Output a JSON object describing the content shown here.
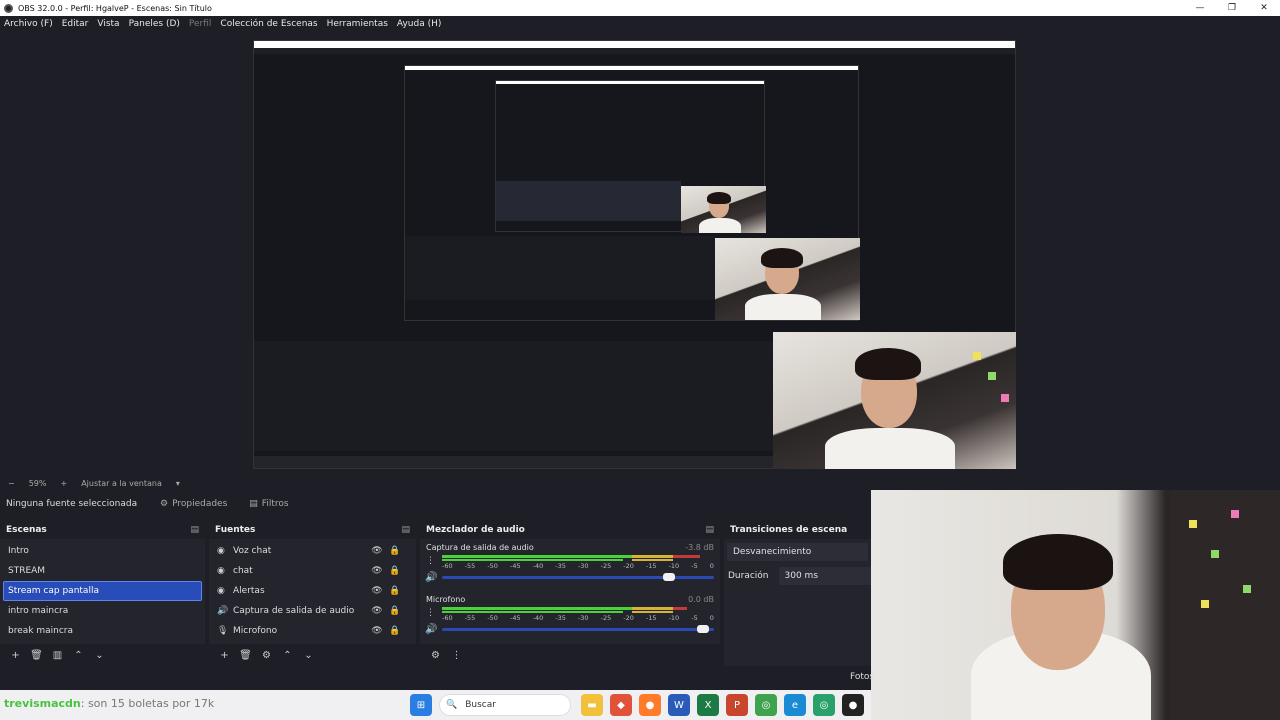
{
  "window": {
    "title": "OBS 32.0.0 - Perfil: HgalveP - Escenas: Sin Título",
    "controls": [
      "—",
      "❐",
      "✕"
    ]
  },
  "menu": [
    {
      "label": "Archivo (F)",
      "disabled": false
    },
    {
      "label": "Editar",
      "disabled": false
    },
    {
      "label": "Vista",
      "disabled": false
    },
    {
      "label": "Paneles (D)",
      "disabled": false
    },
    {
      "label": "Perfil",
      "disabled": true
    },
    {
      "label": "Colección de Escenas",
      "disabled": false
    },
    {
      "label": "Herramientas",
      "disabled": false
    },
    {
      "label": "Ayuda (H)",
      "disabled": false
    }
  ],
  "zoom": {
    "minus": "−",
    "value": "59%",
    "plus": "+",
    "fit_label": "Ajustar a la ventana",
    "dropdown": "▾"
  },
  "source_toolbar": {
    "no_selection": "Ninguna fuente seleccionada",
    "properties": "Propiedades",
    "filters": "Filtros",
    "properties_icon": "⚙",
    "filters_icon": "▤"
  },
  "scenes": {
    "title": "Escenas",
    "menu_icon": "▤",
    "items": [
      "Intro",
      "STREAM",
      "Stream cap pantalla",
      "intro maincra",
      "break maincra"
    ],
    "selected_index": 2,
    "footer_icons": [
      "+",
      "🗑",
      "▥",
      "⌃",
      "⌄"
    ]
  },
  "sources": {
    "title": "Fuentes",
    "menu_icon": "▤",
    "items": [
      {
        "label": "Voz chat",
        "icon": "◉"
      },
      {
        "label": "chat",
        "icon": "◉"
      },
      {
        "label": "Alertas",
        "icon": "◉"
      },
      {
        "label": "Captura de salida de audio",
        "icon": "🔊"
      },
      {
        "label": "Microfono",
        "icon": "🎙"
      }
    ],
    "eye_icon": "👁",
    "lock_icon": "🔒",
    "footer_icons": [
      "+",
      "🗑",
      "⚙",
      "⌃",
      "⌄"
    ]
  },
  "mixer": {
    "title": "Mezclador de audio",
    "menu_icon": "▤",
    "channels": [
      {
        "name": "Captura de salida de audio",
        "db": "-3.8 dB",
        "level": 0.95,
        "fader": 0.85
      },
      {
        "name": "Microfono",
        "db": "0.0 dB",
        "level": 0.9,
        "fader": 0.98
      }
    ],
    "ticks": [
      "-60",
      "-55",
      "-50",
      "-45",
      "-40",
      "-35",
      "-30",
      "-25",
      "-20",
      "-15",
      "-10",
      "-5",
      "0"
    ],
    "kebab": "⋮",
    "volume_icon": "🔊",
    "footer_icons": [
      "⚙",
      "⋮"
    ]
  },
  "transitions": {
    "title": "Transiciones de escena",
    "transition": "Desvanecimiento",
    "duration_label": "Duración",
    "duration_value": "300 ms"
  },
  "taskbar": {
    "stream_user": "trevismacdn",
    "stream_message": ": son 15 boletas por 17k",
    "search_label": "Buscar",
    "search_icon": "🔍",
    "fotos_label": "Fotos"
  },
  "colors": {
    "selected": "#284cb8",
    "meter_green": "#4bd23a",
    "meter_yellow": "#d6b43a",
    "meter_red": "#c33a3a",
    "fader_blue": "#2b49b3"
  }
}
